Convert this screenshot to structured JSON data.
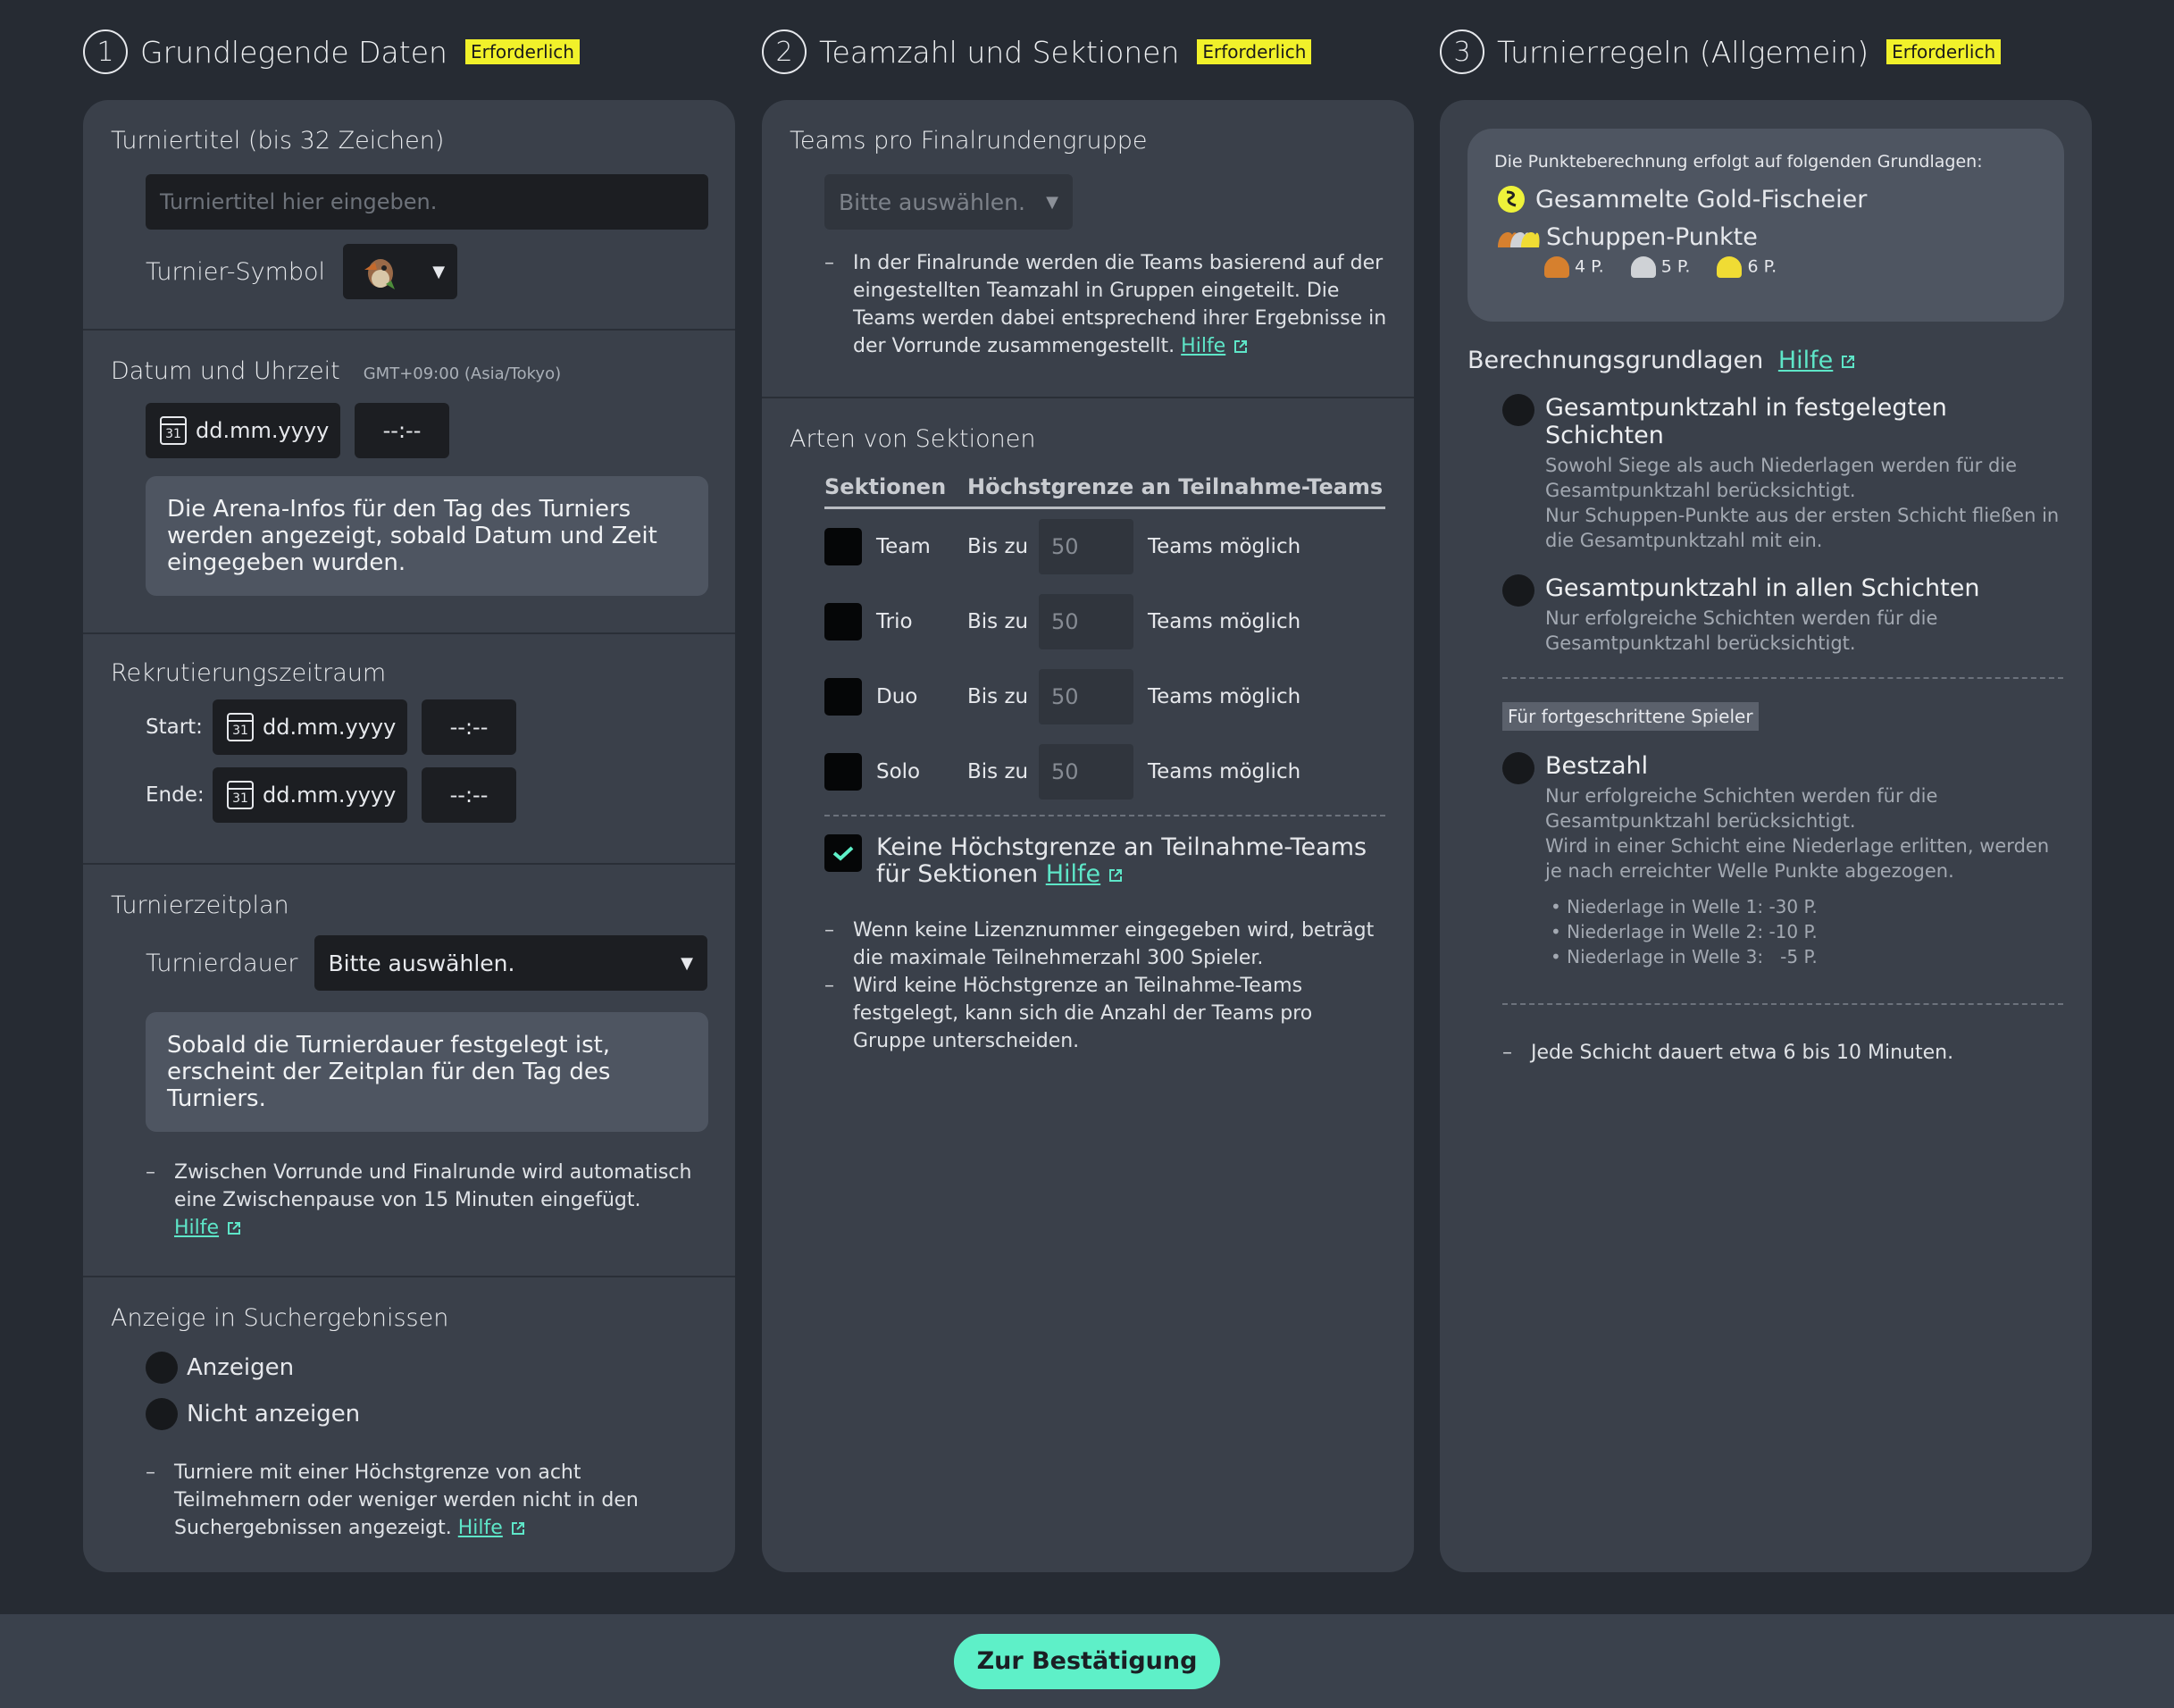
{
  "columns": {
    "c1": {
      "num": "1",
      "title": "Grundlegende Daten",
      "badge": "Erforderlich"
    },
    "c2": {
      "num": "2",
      "title": "Teamzahl und Sektionen",
      "badge": "Erforderlich"
    },
    "c3": {
      "num": "3",
      "title": "Turnierregeln (Allgemein)",
      "badge": "Erforderlich"
    }
  },
  "basic": {
    "title_label": "Turniertitel (bis 32 Zeichen)",
    "title_placeholder": "Turniertitel hier eingeben.",
    "symbol_label": "Turnier-Symbol",
    "datetime_label": "Datum und Uhrzeit",
    "timezone": "GMT+09:00 (Asia/Tokyo)",
    "date_placeholder": "dd.mm.yyyy",
    "time_placeholder": "--:--",
    "cal_day": "31",
    "arena_info": "Die Arena-Infos für den Tag des Turniers werden angezeigt, sobald Datum und Zeit eingegeben wurden.",
    "recruit_label": "Rekrutierungszeitraum",
    "start_label": "Start:",
    "end_label": "Ende:",
    "schedule_label": "Turnierzeitplan",
    "duration_label": "Turnierdauer",
    "duration_value": "Bitte auswählen.",
    "schedule_info": "Sobald die Turnierdauer festgelegt ist, erscheint der Zeitplan für den Tag des Turniers.",
    "schedule_note": "Zwischen Vorrunde und Finalrunde wird automatisch eine Zwischenpause von 15 Minuten eingefügt.",
    "help": "Hilfe",
    "search_label": "Anzeige in Suchergebnissen",
    "show": "Anzeigen",
    "hide": "Nicht anzeigen",
    "search_note": "Turniere mit einer Höchstgrenze von acht Teilmehmern oder weniger werden nicht in den Suchergebnissen angezeigt."
  },
  "teams": {
    "group_label": "Teams pro Finalrundengruppe",
    "group_select": "Bitte auswählen.",
    "group_note": "In der Finalrunde werden die Teams basierend auf der eingestellten Teamzahl in Gruppen eingeteilt. Die Teams werden dabei entsprechend ihrer Ergebnisse in der Vorrunde zusammengestellt.",
    "help": "Hilfe",
    "sections_label": "Arten von Sektionen",
    "th_sections": "Sektionen",
    "th_limit": "Höchstgrenze an Teilnahme-Teams",
    "upto": "Bis zu",
    "possible": "Teams möglich",
    "rows": [
      {
        "name": "Team",
        "value": "50"
      },
      {
        "name": "Trio",
        "value": "50"
      },
      {
        "name": "Duo",
        "value": "50"
      },
      {
        "name": "Solo",
        "value": "50"
      }
    ],
    "nolimit_label": "Keine Höchstgrenze an Teilnahme-Teams für Sektionen",
    "nolimit_checked": true,
    "note1": "Wenn keine Lizenznummer eingegeben wird, beträgt die maximale Teilnehmerzahl 300 Spieler.",
    "note2": "Wird keine Höchstgrenze an Teilnahme-Teams festgelegt, kann sich die Anzahl der Teams pro Gruppe unterscheiden."
  },
  "rules": {
    "points_intro": "Die Punkteberechnung erfolgt auf folgenden Grundlagen:",
    "gold": "Gesammelte Gold-Fischeier",
    "scales": "Schuppen-Punkte",
    "scale_bronze": "4 P.",
    "scale_silver": "5 P.",
    "scale_gold": "6 P.",
    "calc_label": "Berechnungsgrundlagen",
    "help": "Hilfe",
    "opt1_title": "Gesamtpunktzahl in festgelegten Schichten",
    "opt1_desc1": "Sowohl Siege als auch Niederlagen werden für die Gesamtpunktzahl berücksichtigt.",
    "opt1_desc2": "Nur Schuppen-Punkte aus der ersten Schicht fließen in die Gesamtpunktzahl mit ein.",
    "opt2_title": "Gesamtpunktzahl in allen Schichten",
    "opt2_desc": "Nur erfolgreiche Schichten werden für die Gesamtpunktzahl berücksichtigt.",
    "advanced": "Für fortgeschrittene Spieler",
    "opt3_title": "Bestzahl",
    "opt3_desc1": "Nur erfolgreiche Schichten werden für die Gesamtpunktzahl berücksichtigt.",
    "opt3_desc2": "Wird in einer Schicht eine Niederlage erlitten, werden je nach erreichter Welle Punkte abgezogen.",
    "losses": [
      "Niederlage in Welle 1: -30 P.",
      "Niederlage in Welle 2: -10 P.",
      "Niederlage in Welle 3:   -5 P."
    ],
    "shift_note": "Jede Schicht dauert etwa 6 bis 10 Minuten."
  },
  "footer": {
    "confirm": "Zur Bestätigung"
  },
  "colors": {
    "accent": "#5ef0c8",
    "badge": "#f1f12a",
    "bg": "#262b33",
    "panel": "#3a404a"
  }
}
